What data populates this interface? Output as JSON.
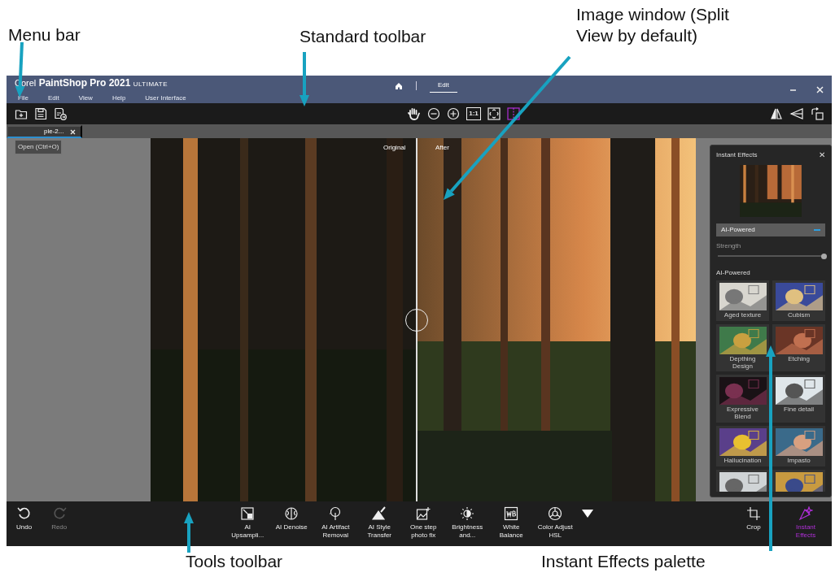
{
  "annotations": [
    {
      "text": "Menu bar"
    },
    {
      "text": "Standard toolbar"
    },
    {
      "text": "Image window (Split View by default)"
    },
    {
      "text": "Tools toolbar"
    },
    {
      "text": "Instant Effects palette"
    }
  ],
  "title_bar": {
    "brand": "Corel",
    "product": "PaintShop Pro 2021",
    "edition": "ULTIMATE",
    "menu": [
      "File",
      "Edit",
      "View",
      "Help",
      "User Interface"
    ],
    "workspace_tabs": [
      {
        "label": "Edit",
        "selected": true
      }
    ]
  },
  "standard_toolbar": {
    "actual_size_label": "1:1",
    "split_view_selected": true
  },
  "document_tab": {
    "label": "ple-2...",
    "tooltip": "Open (Ctrl+O)"
  },
  "image_window": {
    "split_labels": [
      "Original",
      "After"
    ]
  },
  "palette": {
    "title": "Instant Effects",
    "close": "✕",
    "category": "AI-Powered",
    "strength": {
      "label": "Strength",
      "level": 1.0
    },
    "section": "AI-Powered",
    "effects": [
      {
        "label": "Aged texture"
      },
      {
        "label": "Cubism"
      },
      {
        "label": "Depthing Design"
      },
      {
        "label": "Etching"
      },
      {
        "label": "Expressive Blend"
      },
      {
        "label": "Fine detail"
      },
      {
        "label": "Hallucination"
      },
      {
        "label": "Impasto"
      }
    ]
  },
  "tools_toolbar": {
    "history": [
      {
        "label": "Undo",
        "disabled": false
      },
      {
        "label": "Redo",
        "disabled": true
      }
    ],
    "tools": [
      "AI Upsampli...",
      "AI Denoise",
      "AI Artifact Removal",
      "AI Style Transfer",
      "One step photo fix",
      "Brightness and...",
      "White Balance",
      "Color Adjust HSL"
    ],
    "right_tools": [
      {
        "label": "Crop",
        "selected": false
      },
      {
        "label": "Instant Effects",
        "selected": true
      }
    ]
  }
}
